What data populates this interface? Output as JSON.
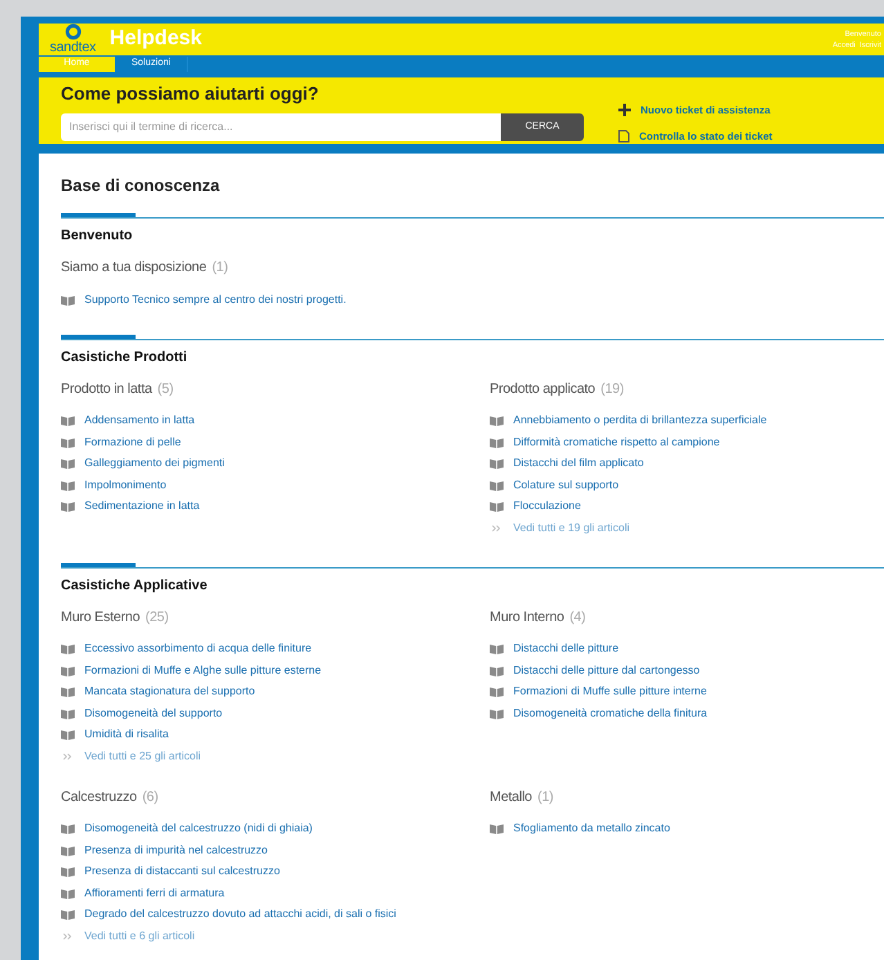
{
  "header": {
    "logo": "sandtex",
    "title": "Helpdesk",
    "welcome": "Benvenuto",
    "links": [
      "Accedi",
      "Iscrivit"
    ]
  },
  "nav": [
    {
      "label": "Home",
      "selected": true
    },
    {
      "label": "Soluzioni",
      "selected": false
    }
  ],
  "search": {
    "heading": "Come possiamo aiutarti oggi?",
    "placeholder": "Inserisci qui il termine di ricerca...",
    "button": "CERCA"
  },
  "actions": [
    {
      "kind": "new",
      "label": "Nuovo ticket di assistenza"
    },
    {
      "kind": "status",
      "label": "Controlla lo stato dei ticket"
    }
  ],
  "knowledge_base": {
    "title": "Base di conoscenza",
    "sections": [
      {
        "title": "Benvenuto",
        "groups": [
          {
            "name": "Siamo a tua disposizione",
            "count": "(1)",
            "articles": [
              "Supporto Tecnico sempre al centro dei nostri progetti."
            ]
          }
        ]
      },
      {
        "title": "Casistiche Prodotti",
        "groups": [
          {
            "name": "Prodotto in latta",
            "count": "(5)",
            "articles": [
              "Addensamento in latta",
              "Formazione di pelle",
              "Galleggiamento dei pigmenti",
              "Impolmonimento",
              "Sedimentazione in latta"
            ]
          },
          {
            "name": "Prodotto applicato",
            "count": "(19)",
            "articles": [
              "Annebbiamento o perdita di brillantezza superficiale",
              "Difformità cromatiche rispetto al campione",
              "Distacchi del film applicato",
              "Colature sul supporto",
              "Flocculazione"
            ],
            "more": "Vedi tutti e 19 gli articoli"
          }
        ]
      },
      {
        "title": "Casistiche Applicative",
        "groups": [
          {
            "name": "Muro Esterno",
            "count": "(25)",
            "articles": [
              "Eccessivo assorbimento di acqua delle finiture",
              "Formazioni di Muffe e Alghe sulle pitture esterne",
              "Mancata stagionatura del supporto",
              "Disomogeneità del supporto",
              "Umidità di risalita"
            ],
            "more": "Vedi tutti e 25 gli articoli"
          },
          {
            "name": "Muro Interno",
            "count": "(4)",
            "articles": [
              "Distacchi delle pitture",
              "Distacchi delle pitture dal cartongesso",
              "Formazioni di Muffe sulle pitture interne",
              "Disomogeneità cromatiche della finitura"
            ]
          },
          {
            "name": "Calcestruzzo",
            "count": "(6)",
            "articles": [
              "Disomogeneità del calcestruzzo (nidi di ghiaia)",
              "Presenza di impurità nel calcestruzzo",
              "Presenza di distaccanti sul calcestruzzo",
              "Affioramenti ferri di armatura",
              "Degrado del calcestruzzo dovuto ad attacchi acidi, di sali o fisici"
            ],
            "more": "Vedi tutti e 6 gli articoli"
          },
          {
            "name": "Metallo",
            "count": "(1)",
            "articles": [
              "Sfogliamento da metallo zincato"
            ]
          }
        ]
      }
    ]
  }
}
